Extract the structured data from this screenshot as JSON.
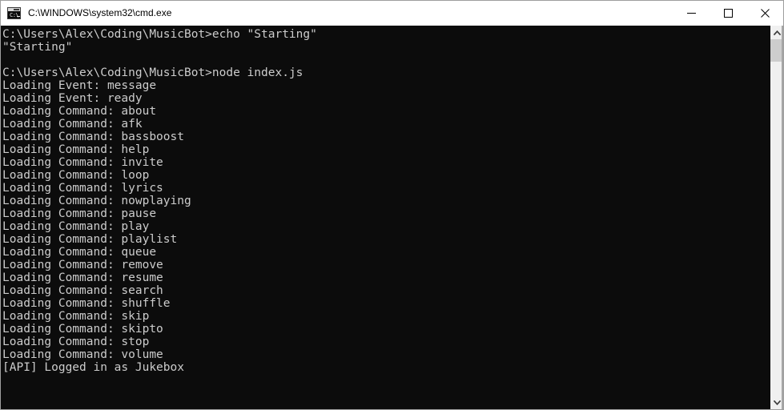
{
  "window": {
    "title": "C:\\WINDOWS\\system32\\cmd.exe",
    "icon": "cmd-console-icon",
    "icon_prompt_text": "C:\\",
    "background_color": "#0c0c0c",
    "foreground_color": "#cccccc",
    "titlebar_color": "#ffffff"
  },
  "titlebar_buttons": {
    "minimize_label": "Minimize",
    "maximize_label": "Maximize",
    "close_label": "Close"
  },
  "scrollbar": {
    "up_arrow_label": "Scroll up",
    "down_arrow_label": "Scroll down",
    "thumb_label": "Scroll thumb"
  },
  "console": {
    "prompt_path": "C:\\Users\\Alex\\Coding\\MusicBot",
    "lines": [
      "C:\\Users\\Alex\\Coding\\MusicBot>echo \"Starting\"",
      "\"Starting\"",
      "",
      "C:\\Users\\Alex\\Coding\\MusicBot>node index.js",
      "Loading Event: message",
      "Loading Event: ready",
      "Loading Command: about",
      "Loading Command: afk",
      "Loading Command: bassboost",
      "Loading Command: help",
      "Loading Command: invite",
      "Loading Command: loop",
      "Loading Command: lyrics",
      "Loading Command: nowplaying",
      "Loading Command: pause",
      "Loading Command: play",
      "Loading Command: playlist",
      "Loading Command: queue",
      "Loading Command: remove",
      "Loading Command: resume",
      "Loading Command: search",
      "Loading Command: shuffle",
      "Loading Command: skip",
      "Loading Command: skipto",
      "Loading Command: stop",
      "Loading Command: volume",
      "[API] Logged in as Jukebox"
    ],
    "events": [
      "message",
      "ready"
    ],
    "commands": [
      "about",
      "afk",
      "bassboost",
      "help",
      "invite",
      "loop",
      "lyrics",
      "nowplaying",
      "pause",
      "play",
      "playlist",
      "queue",
      "remove",
      "resume",
      "search",
      "shuffle",
      "skip",
      "skipto",
      "stop",
      "volume"
    ],
    "api_status": "[API] Logged in as Jukebox",
    "bot_name": "Jukebox"
  }
}
